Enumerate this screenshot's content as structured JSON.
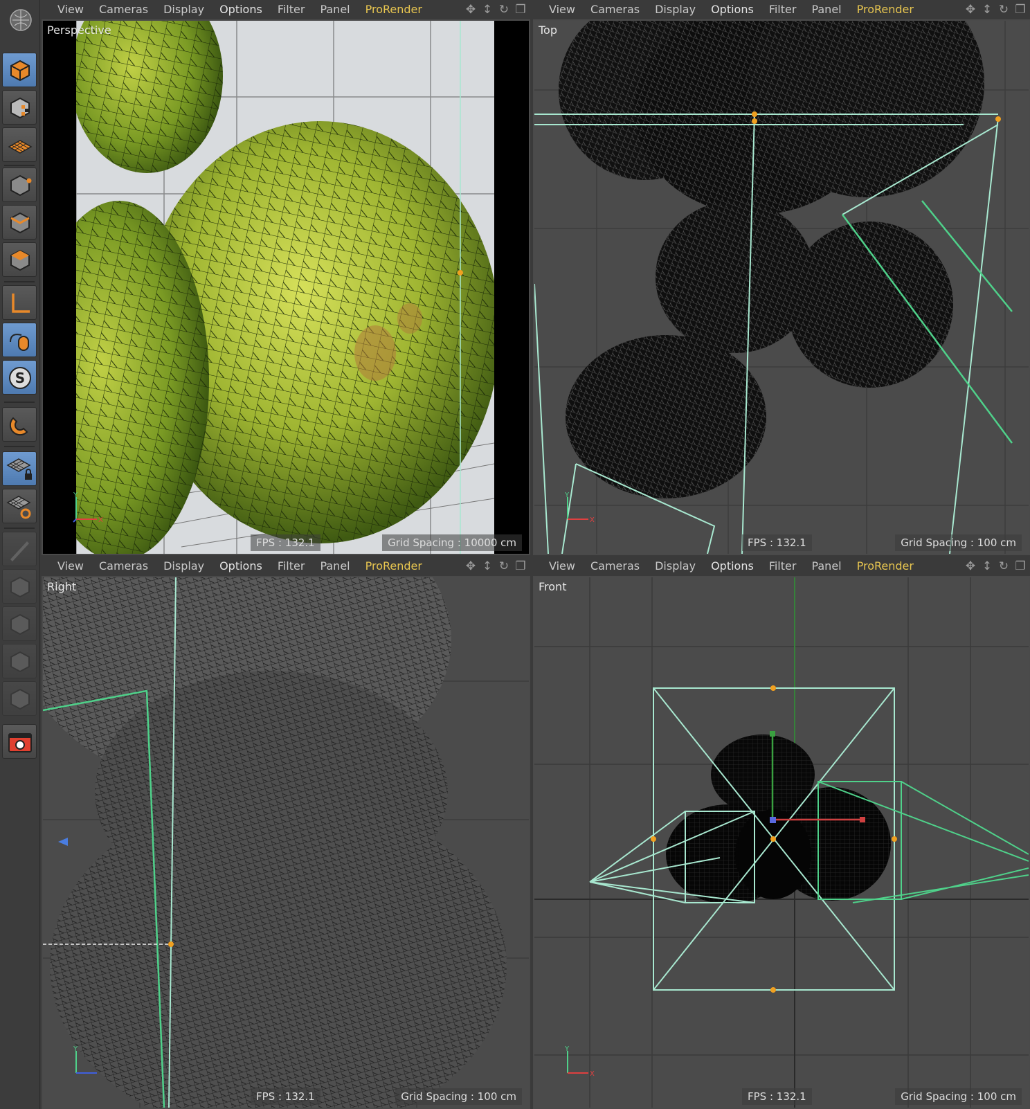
{
  "menu": {
    "items": [
      "View",
      "Cameras",
      "Display",
      "Options",
      "Filter",
      "Panel",
      "ProRender"
    ]
  },
  "viewports": [
    {
      "title": "Perspective",
      "fps": "FPS : 132.1",
      "grid": "Grid Spacing : 10000 cm"
    },
    {
      "title": "Top",
      "fps": "FPS : 132.1",
      "grid": "Grid Spacing : 100 cm"
    },
    {
      "title": "Right",
      "fps": "FPS : 132.1",
      "grid": "Grid Spacing : 100 cm"
    },
    {
      "title": "Front",
      "fps": "FPS : 132.1",
      "grid": "Grid Spacing : 100 cm"
    }
  ],
  "axes": {
    "y": "Y",
    "x": "X"
  },
  "tools": [
    {
      "name": "undo-view-icon"
    },
    {
      "name": "model-mode-icon"
    },
    {
      "name": "texture-mode-icon"
    },
    {
      "name": "workplane-mode-icon"
    },
    {
      "name": "points-mode-icon"
    },
    {
      "name": "edges-mode-icon"
    },
    {
      "name": "polygons-mode-icon"
    },
    {
      "name": "axis-mode-icon"
    },
    {
      "name": "tweak-mode-icon"
    },
    {
      "name": "solo-icon"
    },
    {
      "name": "snap-magnet-icon"
    },
    {
      "name": "locked-workplane-icon"
    },
    {
      "name": "planar-workplane-icon"
    },
    {
      "name": "knife-icon"
    },
    {
      "name": "disabled-cube-1-icon"
    },
    {
      "name": "disabled-cube-2-icon"
    },
    {
      "name": "disabled-cube-3-icon"
    },
    {
      "name": "disabled-cube-4-icon"
    },
    {
      "name": "render-view-icon"
    }
  ],
  "colors": {
    "accent": "#e8c650",
    "selection": "#a8e8d0",
    "spline": "#4fd18a",
    "handle": "#f0a020"
  }
}
